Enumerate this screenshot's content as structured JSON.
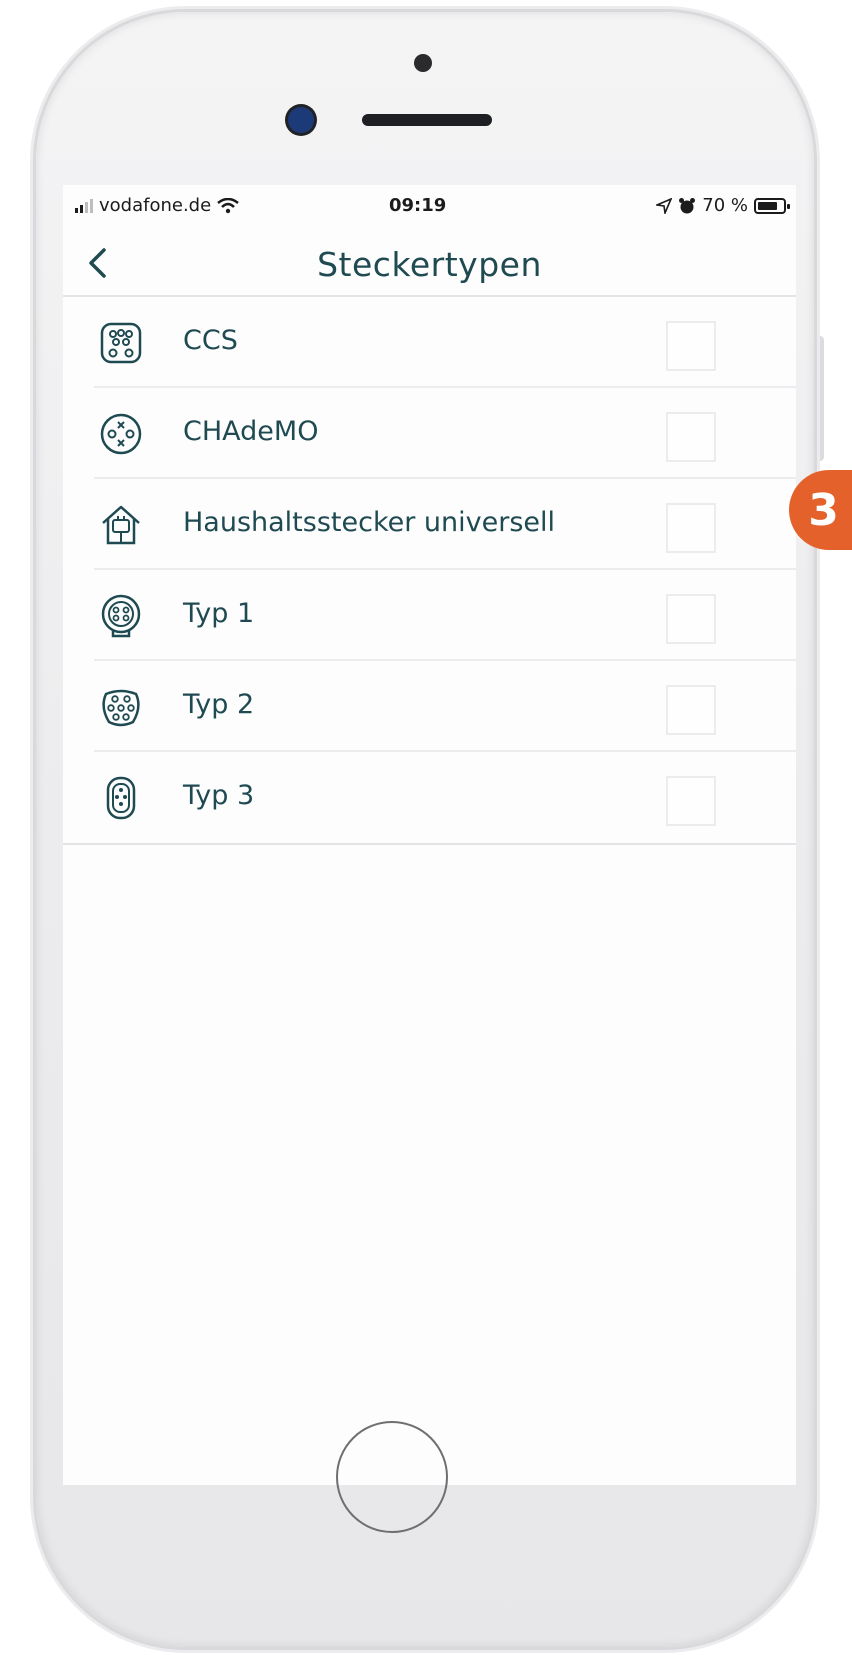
{
  "status_bar": {
    "carrier": "vodafone.de",
    "time": "09:19",
    "battery": "70 %",
    "battery_level": 0.7,
    "icons": [
      "signal-icon",
      "wifi-icon",
      "location-icon",
      "alarm-icon",
      "battery-icon"
    ]
  },
  "nav": {
    "title": "Steckertypen",
    "back_icon": "chevron-left-icon"
  },
  "connectors": [
    {
      "label": "CCS",
      "icon": "ccs-plug-icon",
      "checked": false
    },
    {
      "label": "CHAdeMO",
      "icon": "chademo-plug-icon",
      "checked": false
    },
    {
      "label": "Haushaltsstecker universell",
      "icon": "household-plug-icon",
      "checked": false
    },
    {
      "label": "Typ 1",
      "icon": "type1-plug-icon",
      "checked": false
    },
    {
      "label": "Typ 2",
      "icon": "type2-plug-icon",
      "checked": false
    },
    {
      "label": "Typ 3",
      "icon": "type3-plug-icon",
      "checked": false
    }
  ],
  "callout": {
    "number": "3",
    "color": "#e4612b"
  },
  "colors": {
    "accent": "#1f4a52",
    "callout": "#e4612b"
  }
}
